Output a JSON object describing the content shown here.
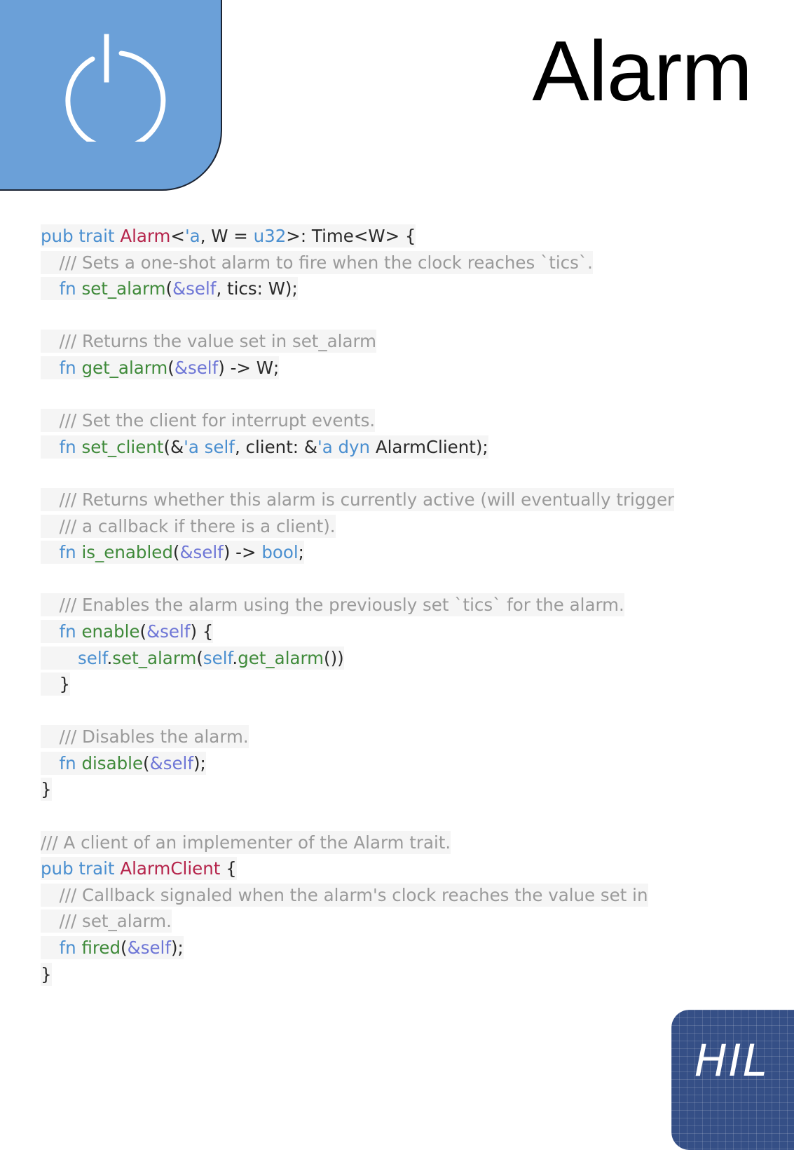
{
  "header": {
    "title": "Alarm",
    "icon": "power-icon",
    "colors": {
      "tab": "#6ba0d8",
      "tab_border": "#1c2433"
    }
  },
  "code_lines": [
    {
      "indent": 0,
      "tokens": [
        [
          "kw",
          "pub trait "
        ],
        [
          "ty",
          "Alarm"
        ],
        [
          "pl",
          "<"
        ],
        [
          "kw",
          "'a"
        ],
        [
          "pl",
          ", W = "
        ],
        [
          "kw",
          "u32"
        ],
        [
          "pl",
          ">: Time<W> {"
        ]
      ]
    },
    {
      "indent": 1,
      "tokens": [
        [
          "cm",
          "/// Sets a one-shot alarm to fire when the clock reaches `tics`."
        ]
      ]
    },
    {
      "indent": 1,
      "tokens": [
        [
          "kw",
          "fn "
        ],
        [
          "fn",
          "set_alarm"
        ],
        [
          "pl",
          "("
        ],
        [
          "ref",
          "&self"
        ],
        [
          "pl",
          ", tics: W);"
        ]
      ]
    },
    {
      "indent": 0,
      "tokens": []
    },
    {
      "indent": 1,
      "tokens": [
        [
          "cm",
          "/// Returns the value set in set_alarm"
        ]
      ]
    },
    {
      "indent": 1,
      "tokens": [
        [
          "kw",
          "fn "
        ],
        [
          "fn",
          "get_alarm"
        ],
        [
          "pl",
          "("
        ],
        [
          "ref",
          "&self"
        ],
        [
          "pl",
          ") -> W;"
        ]
      ]
    },
    {
      "indent": 0,
      "tokens": []
    },
    {
      "indent": 1,
      "tokens": [
        [
          "cm",
          "/// Set the client for interrupt events."
        ]
      ]
    },
    {
      "indent": 1,
      "tokens": [
        [
          "kw",
          "fn "
        ],
        [
          "fn",
          "set_client"
        ],
        [
          "pl",
          "(&"
        ],
        [
          "kw",
          "'a self"
        ],
        [
          "pl",
          ", client: &"
        ],
        [
          "kw",
          "'a dyn "
        ],
        [
          "pl",
          "AlarmClient);"
        ]
      ]
    },
    {
      "indent": 0,
      "tokens": []
    },
    {
      "indent": 1,
      "tokens": [
        [
          "cm",
          "/// Returns whether this alarm is currently active (will eventually trigger"
        ]
      ]
    },
    {
      "indent": 1,
      "tokens": [
        [
          "cm",
          "/// a callback if there is a client)."
        ]
      ]
    },
    {
      "indent": 1,
      "tokens": [
        [
          "kw",
          "fn "
        ],
        [
          "fn",
          "is_enabled"
        ],
        [
          "pl",
          "("
        ],
        [
          "ref",
          "&self"
        ],
        [
          "pl",
          ") -> "
        ],
        [
          "kw",
          "bool"
        ],
        [
          "pl",
          ";"
        ]
      ]
    },
    {
      "indent": 0,
      "tokens": []
    },
    {
      "indent": 1,
      "tokens": [
        [
          "cm",
          "/// Enables the alarm using the previously set `tics` for the alarm."
        ]
      ]
    },
    {
      "indent": 1,
      "tokens": [
        [
          "kw",
          "fn "
        ],
        [
          "fn",
          "enable"
        ],
        [
          "pl",
          "("
        ],
        [
          "ref",
          "&self"
        ],
        [
          "pl",
          ") {"
        ]
      ]
    },
    {
      "indent": 2,
      "tokens": [
        [
          "kw",
          "self"
        ],
        [
          "pl",
          "."
        ],
        [
          "fn",
          "set_alarm"
        ],
        [
          "pl",
          "("
        ],
        [
          "kw",
          "self"
        ],
        [
          "pl",
          "."
        ],
        [
          "fn",
          "get_alarm"
        ],
        [
          "pl",
          "())"
        ]
      ]
    },
    {
      "indent": 1,
      "tokens": [
        [
          "pl",
          "}"
        ]
      ]
    },
    {
      "indent": 0,
      "tokens": []
    },
    {
      "indent": 1,
      "tokens": [
        [
          "cm",
          "/// Disables the alarm."
        ]
      ]
    },
    {
      "indent": 1,
      "tokens": [
        [
          "kw",
          "fn "
        ],
        [
          "fn",
          "disable"
        ],
        [
          "pl",
          "("
        ],
        [
          "ref",
          "&self"
        ],
        [
          "pl",
          ");"
        ]
      ]
    },
    {
      "indent": 0,
      "tokens": [
        [
          "pl",
          "}"
        ]
      ]
    },
    {
      "indent": 0,
      "tokens": []
    },
    {
      "indent": 0,
      "tokens": [
        [
          "cm",
          "/// A client of an implementer of the Alarm trait."
        ]
      ]
    },
    {
      "indent": 0,
      "tokens": [
        [
          "kw",
          "pub trait "
        ],
        [
          "ty",
          "AlarmClient"
        ],
        [
          "pl",
          " {"
        ]
      ]
    },
    {
      "indent": 1,
      "tokens": [
        [
          "cm",
          "/// Callback signaled when the alarm's clock reaches the value set in"
        ]
      ]
    },
    {
      "indent": 1,
      "tokens": [
        [
          "cm",
          "/// set_alarm."
        ]
      ]
    },
    {
      "indent": 1,
      "tokens": [
        [
          "kw",
          "fn "
        ],
        [
          "fn",
          "fired"
        ],
        [
          "pl",
          "("
        ],
        [
          "ref",
          "&self"
        ],
        [
          "pl",
          ");"
        ]
      ]
    },
    {
      "indent": 0,
      "tokens": [
        [
          "pl",
          "}"
        ]
      ]
    }
  ],
  "badge": {
    "label": "HIL",
    "color": "#354f86"
  }
}
